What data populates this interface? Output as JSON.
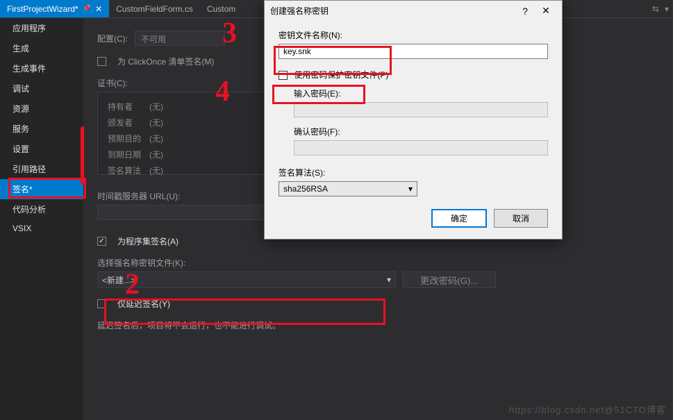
{
  "tabs": {
    "items": [
      {
        "label": "FirstProjectWizard*"
      },
      {
        "label": "CustomFieldForm.cs"
      },
      {
        "label": "Custom"
      }
    ]
  },
  "sidebar": {
    "items": [
      "应用程序",
      "生成",
      "生成事件",
      "调试",
      "资源",
      "服务",
      "设置",
      "引用路径",
      "签名*",
      "代码分析",
      "VSIX"
    ],
    "activeIndex": 8
  },
  "content": {
    "config_label": "配置(C):",
    "config_value": "不可用",
    "clickonce_label": "为 ClickOnce 清单签名(M)",
    "cert_header": "证书(C):",
    "cert": {
      "holder_k": "持有者",
      "holder_v": "(无)",
      "issuer_k": "颁发者",
      "issuer_v": "(无)",
      "purpose_k": "预期目的",
      "purpose_v": "(无)",
      "expiry_k": "到期日期",
      "expiry_v": "(无)",
      "algo_k": "签名算法",
      "algo_v": "(无)"
    },
    "tss_label": "时间戳服务器 URL(U):",
    "sign_assembly_label": "为程序集签名(A)",
    "choose_key_label": "选择强名称密钥文件(K):",
    "choose_key_value": "<新建...>",
    "change_pwd_btn": "更改密码(G)...",
    "delay_sign_label": "仅延迟签名(Y)",
    "delay_hint": "延迟签名后，项目将不会运行，也不能进行调试。"
  },
  "dialog": {
    "title": "创建强名称密钥",
    "file_label": "密钥文件名称(N):",
    "file_value": "key.snk",
    "protect_label": "使用密码保护密钥文件(P)",
    "pwd_label": "输入密码(E):",
    "confirm_label": "确认密码(F):",
    "algo_label": "签名算法(S):",
    "algo_value": "sha256RSA",
    "ok": "确定",
    "cancel": "取消"
  },
  "annotations": {
    "n2": "2",
    "n3": "3",
    "n4": "4"
  },
  "watermark": "https://blog.csdn.net@51CTO博客"
}
